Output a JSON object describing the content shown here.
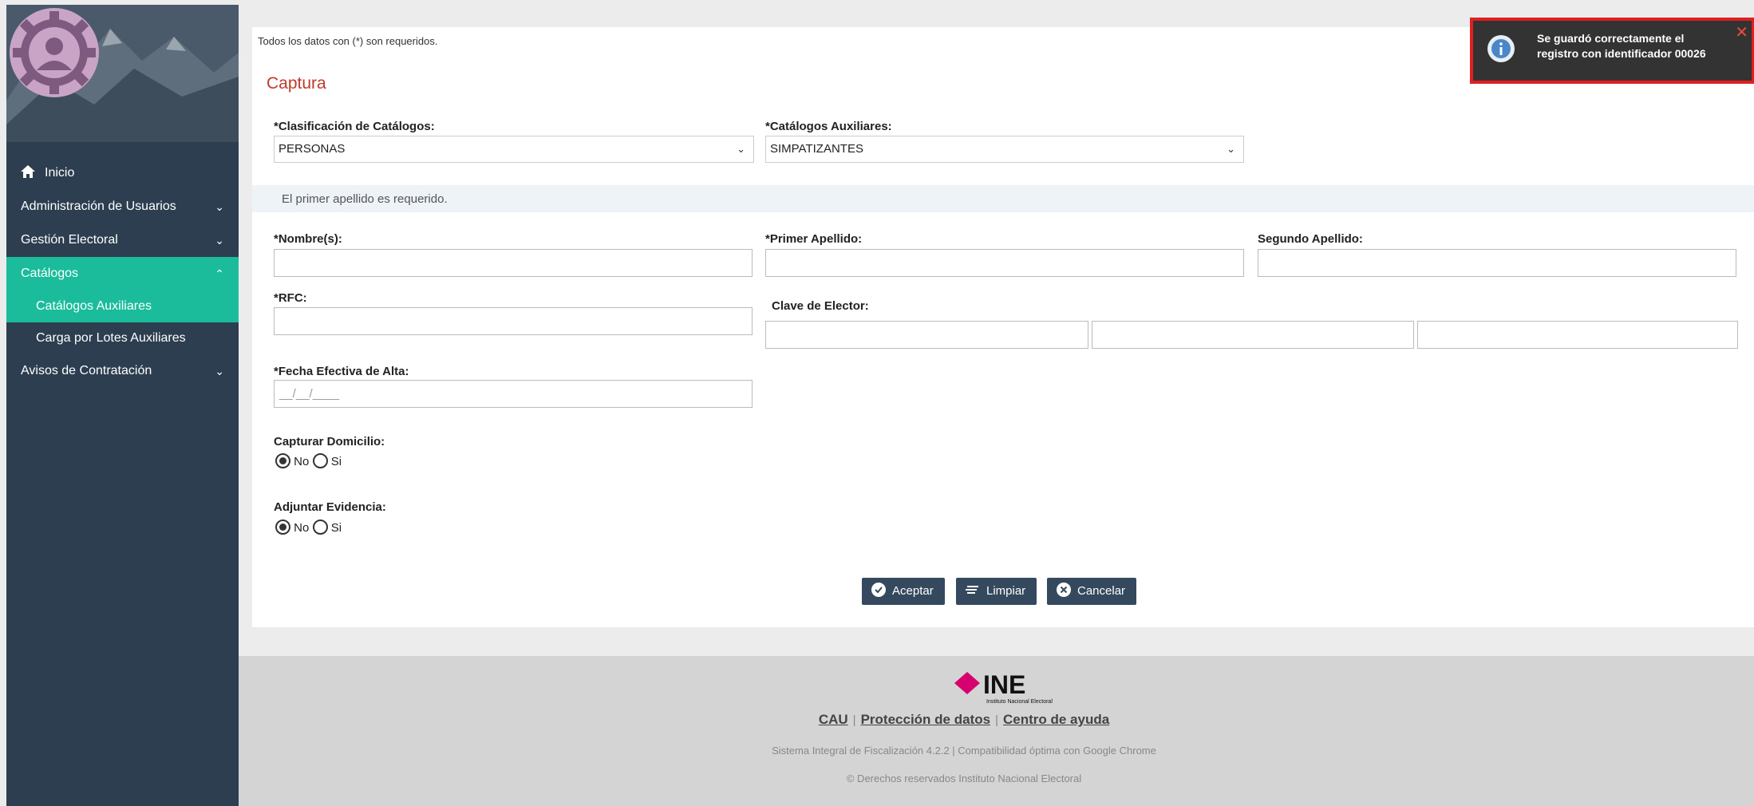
{
  "sidebar": {
    "home_label": "Inicio",
    "items": [
      {
        "label": "Administración de Usuarios"
      },
      {
        "label": "Gestión Electoral"
      },
      {
        "label": "Catálogos"
      },
      {
        "label": "Catálogos Auxiliares"
      },
      {
        "label": "Carga por Lotes Auxiliares"
      },
      {
        "label": "Avisos de Contratación"
      }
    ]
  },
  "form": {
    "required_note": "Todos los datos con (*) son requeridos.",
    "title": "Captura",
    "clasificacion_label": "*Clasificación de Catálogos:",
    "clasificacion_value": "PERSONAS",
    "catalogos_label": "*Catálogos Auxiliares:",
    "catalogos_value": "SIMPATIZANTES",
    "alert": "El primer apellido es requerido.",
    "nombre_label": "*Nombre(s):",
    "primer_apellido_label": "*Primer Apellido:",
    "segundo_apellido_label": "Segundo Apellido:",
    "rfc_label": "*RFC:",
    "clave_elector_label": "Clave de Elector:",
    "fecha_label": "*Fecha Efectiva de Alta:",
    "fecha_placeholder": "__/__/____",
    "capturar_domicilio_label": "Capturar Domicilio:",
    "adjuntar_evidencia_label": "Adjuntar Evidencia:",
    "radio_no": "No",
    "radio_si": "Si",
    "btn_aceptar": "Aceptar",
    "btn_limpiar": "Limpiar",
    "btn_cancelar": "Cancelar"
  },
  "footer": {
    "logo_text": "INE",
    "logo_subtext": "Instituto Nacional Electoral",
    "link_cau": "CAU",
    "link_proteccion": "Protección de datos",
    "link_ayuda": "Centro de ayuda",
    "version_text": "Sistema Integral de Fiscalización 4.2.2 | Compatibilidad óptima con Google Chrome",
    "copyright": "© Derechos reservados Instituto Nacional Electoral"
  },
  "toast": {
    "message": "Se guardó correctamente el registro con identificador 00026"
  },
  "colors": {
    "sidebar_bg": "#2c3e50",
    "active": "#1abc9c",
    "title_red": "#c0392b",
    "button_bg": "#34495e",
    "brand_magenta": "#d6006f"
  }
}
